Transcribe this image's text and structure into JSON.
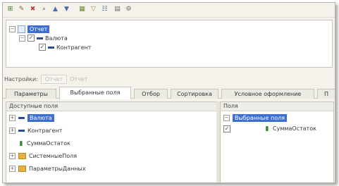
{
  "toolbar": {
    "buttons": [
      {
        "icon": "add-structure-icon",
        "glyph": "⊞",
        "color": "#3a7a2a"
      },
      {
        "icon": "edit-pencil-icon",
        "glyph": "✎",
        "color": "#7a6a2a"
      },
      {
        "icon": "delete-icon",
        "glyph": "✖",
        "color": "#b04040"
      },
      {
        "icon": "find-icon",
        "glyph": "⌕",
        "color": "#555555"
      },
      {
        "icon": "move-up-icon",
        "glyph": "▲",
        "color": "#4a6aa8"
      },
      {
        "icon": "move-down-icon",
        "glyph": "▼",
        "color": "#4a6aa8"
      },
      {
        "icon": "group-icon",
        "glyph": "▦",
        "color": "#6a8a3a"
      },
      {
        "icon": "filter-icon",
        "glyph": "▽",
        "color": "#a88a2a"
      },
      {
        "icon": "tree-view-icon",
        "glyph": "☷",
        "color": "#4a6aa8"
      },
      {
        "icon": "table-view-icon",
        "glyph": "▤",
        "color": "#6a6a6a"
      },
      {
        "icon": "settings-icon",
        "glyph": "⚙",
        "color": "#6a6a6a"
      }
    ]
  },
  "tree": {
    "root": "Отчет",
    "level1": "Валюта",
    "level2": "Контрагент"
  },
  "settings": {
    "label": "Настройки:",
    "option1": "Отчет",
    "option2": "Отчет"
  },
  "tabs": [
    {
      "label": "Параметры",
      "active": false
    },
    {
      "label": "Выбранные поля",
      "active": true
    },
    {
      "label": "Отбор",
      "active": false
    },
    {
      "label": "Сортировка",
      "active": false
    },
    {
      "label": "Условное оформление",
      "active": false
    },
    {
      "label": "П",
      "active": false
    }
  ],
  "available": {
    "header": "Доступные поля",
    "items": [
      {
        "label": "Валюта",
        "icon": "dash-icon",
        "selected": true
      },
      {
        "label": "Контрагент",
        "icon": "dash-icon",
        "selected": false
      },
      {
        "label": "СуммаОстаток",
        "icon": "numeric-field-icon",
        "selected": false
      },
      {
        "label": "СистемныеПоля",
        "icon": "folder-icon",
        "selected": false
      },
      {
        "label": "ПараметрыДанных",
        "icon": "folder-icon",
        "selected": false
      }
    ]
  },
  "selected": {
    "header": "Поля",
    "group_label": "Выбранные поля",
    "field_label": "СуммаОстаток"
  },
  "colors": {
    "selection": "#3c6fd1",
    "window_bg": "#f4f2ea",
    "dash": "#2b4e8c",
    "numeric": "#2f8a2a",
    "folder": "#e2b341"
  }
}
